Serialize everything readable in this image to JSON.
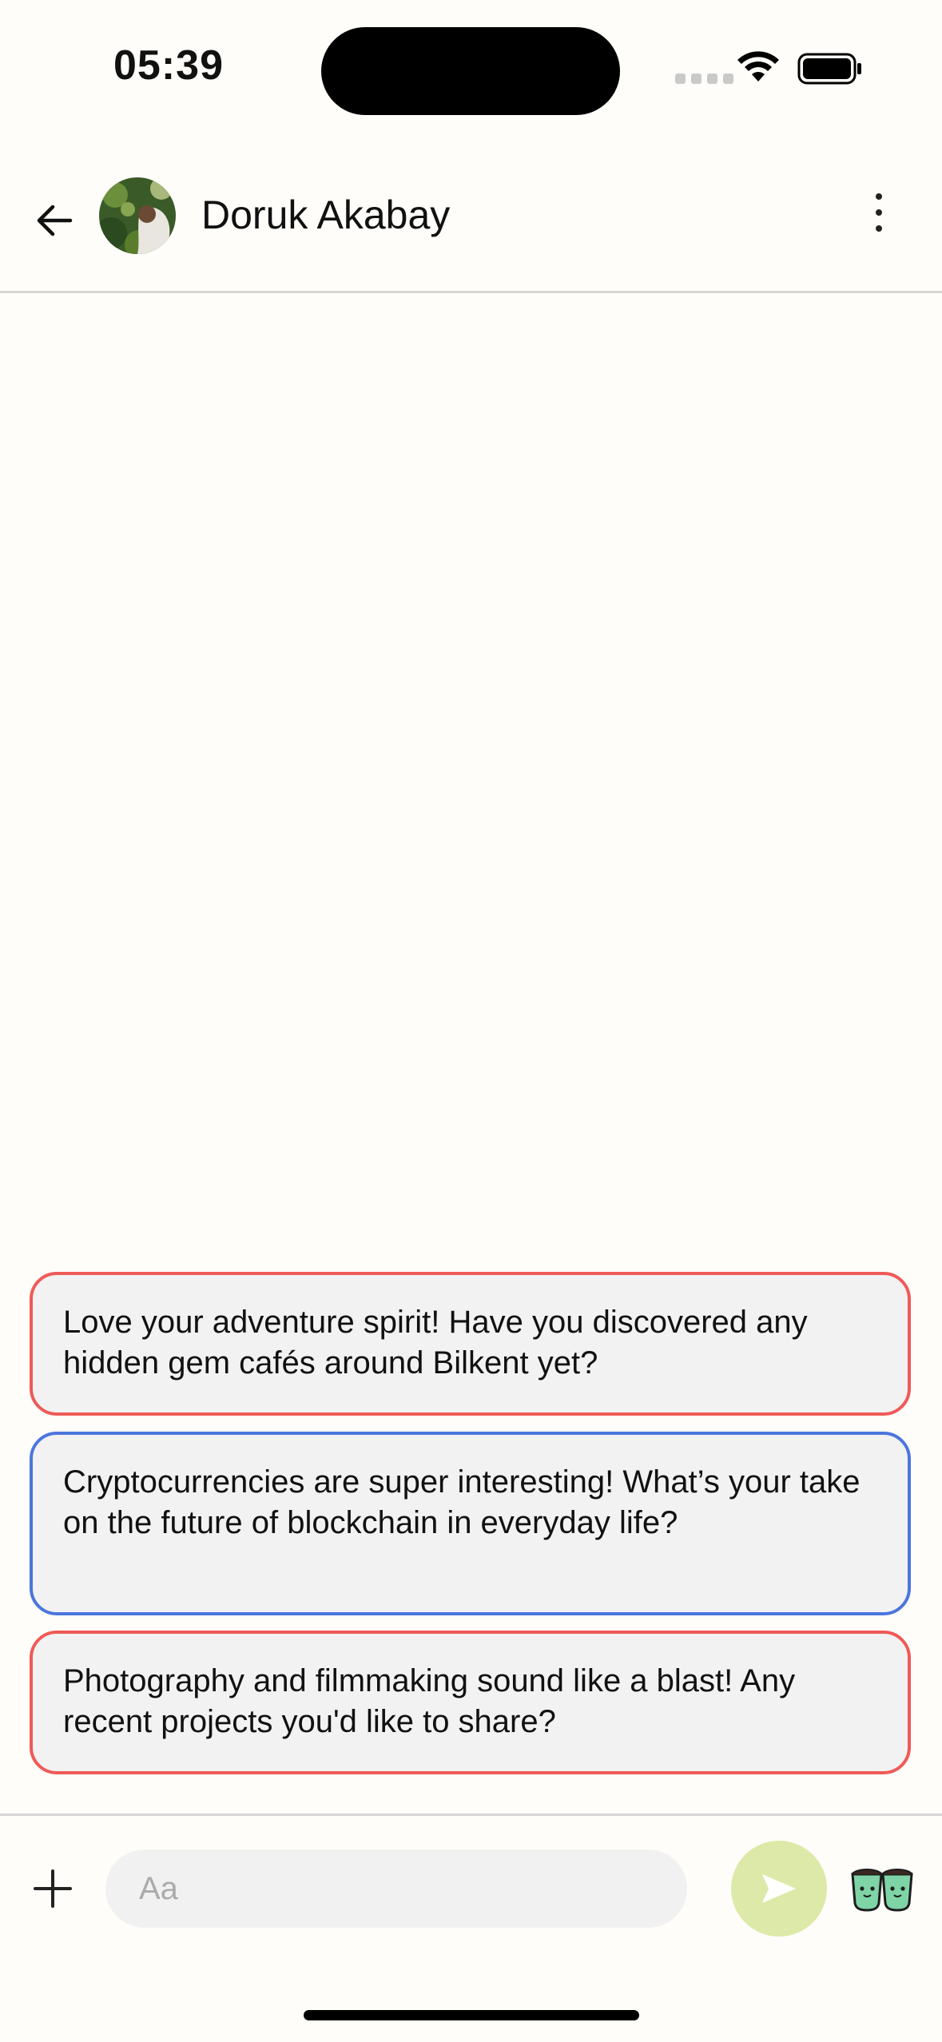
{
  "status_bar": {
    "time": "05:39"
  },
  "header": {
    "contact_name": "Doruk Akabay"
  },
  "suggestions": [
    {
      "text": "Love your adventure spirit! Have you discovered any hidden gem cafés around Bilkent yet?",
      "accent": "#ef5a57"
    },
    {
      "text": "Cryptocurrencies are super interesting! What’s your take on the future of blockchain in everyday life?",
      "accent": "#4c76dd"
    },
    {
      "text": "Photography and filmmaking sound like a blast! Any recent projects you'd like to share?",
      "accent": "#ef5a57"
    }
  ],
  "composer": {
    "placeholder": "Aa",
    "value": ""
  },
  "icons": {
    "back": "arrow-left-icon",
    "more": "more-vertical-icon",
    "plus": "plus-icon",
    "send": "send-icon",
    "mascot": "twin-cups-mascot-icon"
  },
  "colors": {
    "background": "#fefdf9",
    "send_button": "#dde9a8",
    "accent_red": "#ef5a57",
    "accent_blue": "#4c76dd"
  }
}
